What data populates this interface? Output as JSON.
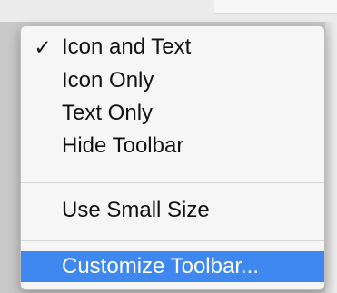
{
  "menu": {
    "items": [
      {
        "label": "Icon and Text",
        "checked": true,
        "check_mark": "✓"
      },
      {
        "label": "Icon Only",
        "checked": false
      },
      {
        "label": "Text Only",
        "checked": false
      },
      {
        "label": "Hide Toolbar",
        "checked": false
      },
      {
        "label": "Use Small Size",
        "checked": false
      },
      {
        "label": "Customize Toolbar...",
        "checked": false,
        "highlighted": true
      }
    ],
    "highlight_color": "#3f88f0"
  }
}
